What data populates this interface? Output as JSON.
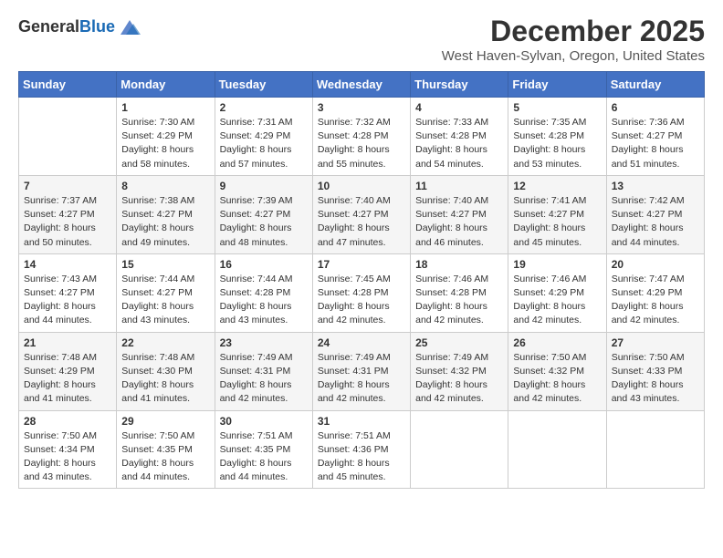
{
  "logo": {
    "text_general": "General",
    "text_blue": "Blue"
  },
  "title": "December 2025",
  "subtitle": "West Haven-Sylvan, Oregon, United States",
  "days_of_week": [
    "Sunday",
    "Monday",
    "Tuesday",
    "Wednesday",
    "Thursday",
    "Friday",
    "Saturday"
  ],
  "weeks": [
    [
      {
        "day": "",
        "sunrise": "",
        "sunset": "",
        "daylight": ""
      },
      {
        "day": "1",
        "sunrise": "Sunrise: 7:30 AM",
        "sunset": "Sunset: 4:29 PM",
        "daylight": "Daylight: 8 hours and 58 minutes."
      },
      {
        "day": "2",
        "sunrise": "Sunrise: 7:31 AM",
        "sunset": "Sunset: 4:29 PM",
        "daylight": "Daylight: 8 hours and 57 minutes."
      },
      {
        "day": "3",
        "sunrise": "Sunrise: 7:32 AM",
        "sunset": "Sunset: 4:28 PM",
        "daylight": "Daylight: 8 hours and 55 minutes."
      },
      {
        "day": "4",
        "sunrise": "Sunrise: 7:33 AM",
        "sunset": "Sunset: 4:28 PM",
        "daylight": "Daylight: 8 hours and 54 minutes."
      },
      {
        "day": "5",
        "sunrise": "Sunrise: 7:35 AM",
        "sunset": "Sunset: 4:28 PM",
        "daylight": "Daylight: 8 hours and 53 minutes."
      },
      {
        "day": "6",
        "sunrise": "Sunrise: 7:36 AM",
        "sunset": "Sunset: 4:27 PM",
        "daylight": "Daylight: 8 hours and 51 minutes."
      }
    ],
    [
      {
        "day": "7",
        "sunrise": "Sunrise: 7:37 AM",
        "sunset": "Sunset: 4:27 PM",
        "daylight": "Daylight: 8 hours and 50 minutes."
      },
      {
        "day": "8",
        "sunrise": "Sunrise: 7:38 AM",
        "sunset": "Sunset: 4:27 PM",
        "daylight": "Daylight: 8 hours and 49 minutes."
      },
      {
        "day": "9",
        "sunrise": "Sunrise: 7:39 AM",
        "sunset": "Sunset: 4:27 PM",
        "daylight": "Daylight: 8 hours and 48 minutes."
      },
      {
        "day": "10",
        "sunrise": "Sunrise: 7:40 AM",
        "sunset": "Sunset: 4:27 PM",
        "daylight": "Daylight: 8 hours and 47 minutes."
      },
      {
        "day": "11",
        "sunrise": "Sunrise: 7:40 AM",
        "sunset": "Sunset: 4:27 PM",
        "daylight": "Daylight: 8 hours and 46 minutes."
      },
      {
        "day": "12",
        "sunrise": "Sunrise: 7:41 AM",
        "sunset": "Sunset: 4:27 PM",
        "daylight": "Daylight: 8 hours and 45 minutes."
      },
      {
        "day": "13",
        "sunrise": "Sunrise: 7:42 AM",
        "sunset": "Sunset: 4:27 PM",
        "daylight": "Daylight: 8 hours and 44 minutes."
      }
    ],
    [
      {
        "day": "14",
        "sunrise": "Sunrise: 7:43 AM",
        "sunset": "Sunset: 4:27 PM",
        "daylight": "Daylight: 8 hours and 44 minutes."
      },
      {
        "day": "15",
        "sunrise": "Sunrise: 7:44 AM",
        "sunset": "Sunset: 4:27 PM",
        "daylight": "Daylight: 8 hours and 43 minutes."
      },
      {
        "day": "16",
        "sunrise": "Sunrise: 7:44 AM",
        "sunset": "Sunset: 4:28 PM",
        "daylight": "Daylight: 8 hours and 43 minutes."
      },
      {
        "day": "17",
        "sunrise": "Sunrise: 7:45 AM",
        "sunset": "Sunset: 4:28 PM",
        "daylight": "Daylight: 8 hours and 42 minutes."
      },
      {
        "day": "18",
        "sunrise": "Sunrise: 7:46 AM",
        "sunset": "Sunset: 4:28 PM",
        "daylight": "Daylight: 8 hours and 42 minutes."
      },
      {
        "day": "19",
        "sunrise": "Sunrise: 7:46 AM",
        "sunset": "Sunset: 4:29 PM",
        "daylight": "Daylight: 8 hours and 42 minutes."
      },
      {
        "day": "20",
        "sunrise": "Sunrise: 7:47 AM",
        "sunset": "Sunset: 4:29 PM",
        "daylight": "Daylight: 8 hours and 42 minutes."
      }
    ],
    [
      {
        "day": "21",
        "sunrise": "Sunrise: 7:48 AM",
        "sunset": "Sunset: 4:29 PM",
        "daylight": "Daylight: 8 hours and 41 minutes."
      },
      {
        "day": "22",
        "sunrise": "Sunrise: 7:48 AM",
        "sunset": "Sunset: 4:30 PM",
        "daylight": "Daylight: 8 hours and 41 minutes."
      },
      {
        "day": "23",
        "sunrise": "Sunrise: 7:49 AM",
        "sunset": "Sunset: 4:31 PM",
        "daylight": "Daylight: 8 hours and 42 minutes."
      },
      {
        "day": "24",
        "sunrise": "Sunrise: 7:49 AM",
        "sunset": "Sunset: 4:31 PM",
        "daylight": "Daylight: 8 hours and 42 minutes."
      },
      {
        "day": "25",
        "sunrise": "Sunrise: 7:49 AM",
        "sunset": "Sunset: 4:32 PM",
        "daylight": "Daylight: 8 hours and 42 minutes."
      },
      {
        "day": "26",
        "sunrise": "Sunrise: 7:50 AM",
        "sunset": "Sunset: 4:32 PM",
        "daylight": "Daylight: 8 hours and 42 minutes."
      },
      {
        "day": "27",
        "sunrise": "Sunrise: 7:50 AM",
        "sunset": "Sunset: 4:33 PM",
        "daylight": "Daylight: 8 hours and 43 minutes."
      }
    ],
    [
      {
        "day": "28",
        "sunrise": "Sunrise: 7:50 AM",
        "sunset": "Sunset: 4:34 PM",
        "daylight": "Daylight: 8 hours and 43 minutes."
      },
      {
        "day": "29",
        "sunrise": "Sunrise: 7:50 AM",
        "sunset": "Sunset: 4:35 PM",
        "daylight": "Daylight: 8 hours and 44 minutes."
      },
      {
        "day": "30",
        "sunrise": "Sunrise: 7:51 AM",
        "sunset": "Sunset: 4:35 PM",
        "daylight": "Daylight: 8 hours and 44 minutes."
      },
      {
        "day": "31",
        "sunrise": "Sunrise: 7:51 AM",
        "sunset": "Sunset: 4:36 PM",
        "daylight": "Daylight: 8 hours and 45 minutes."
      },
      {
        "day": "",
        "sunrise": "",
        "sunset": "",
        "daylight": ""
      },
      {
        "day": "",
        "sunrise": "",
        "sunset": "",
        "daylight": ""
      },
      {
        "day": "",
        "sunrise": "",
        "sunset": "",
        "daylight": ""
      }
    ]
  ]
}
